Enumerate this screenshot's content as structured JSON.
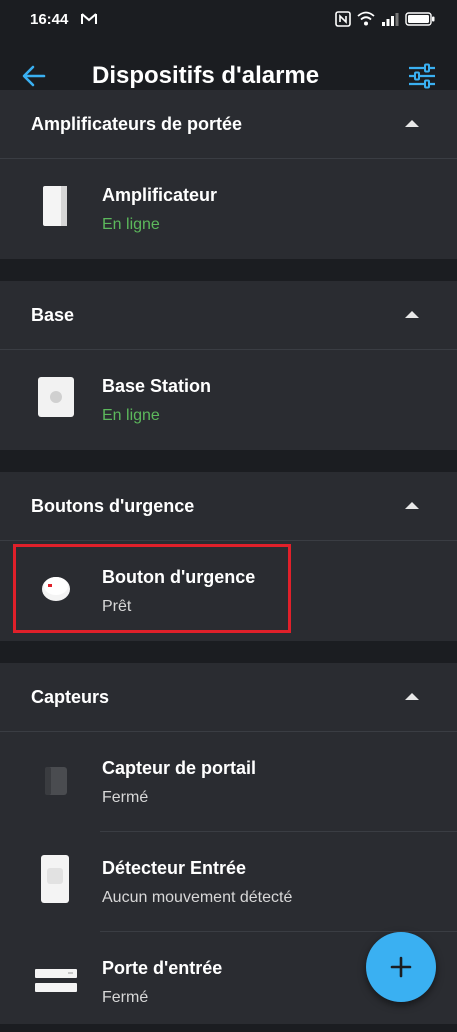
{
  "status_bar": {
    "time": "16:44"
  },
  "app_bar": {
    "title": "Dispositifs d'alarme"
  },
  "sections": [
    {
      "title": "Amplificateurs de portée",
      "items": [
        {
          "name": "Amplificateur",
          "status": "En ligne"
        }
      ]
    },
    {
      "title": "Base",
      "items": [
        {
          "name": "Base Station",
          "status": "En ligne"
        }
      ]
    },
    {
      "title": "Boutons d'urgence",
      "items": [
        {
          "name": "Bouton d'urgence",
          "status": "Prêt"
        }
      ]
    },
    {
      "title": "Capteurs",
      "items": [
        {
          "name": "Capteur de portail",
          "status": "Fermé"
        },
        {
          "name": "Détecteur Entrée",
          "status": "Aucun mouvement détecté"
        },
        {
          "name": "Porte d'entrée",
          "status": "Fermé"
        }
      ]
    }
  ],
  "colors": {
    "accent": "#3ab0f2",
    "online": "#5cb85c",
    "highlight": "#e0202a",
    "background": "#1b1d21",
    "card": "#2a2c31"
  },
  "fab": {
    "icon": "plus-icon"
  }
}
